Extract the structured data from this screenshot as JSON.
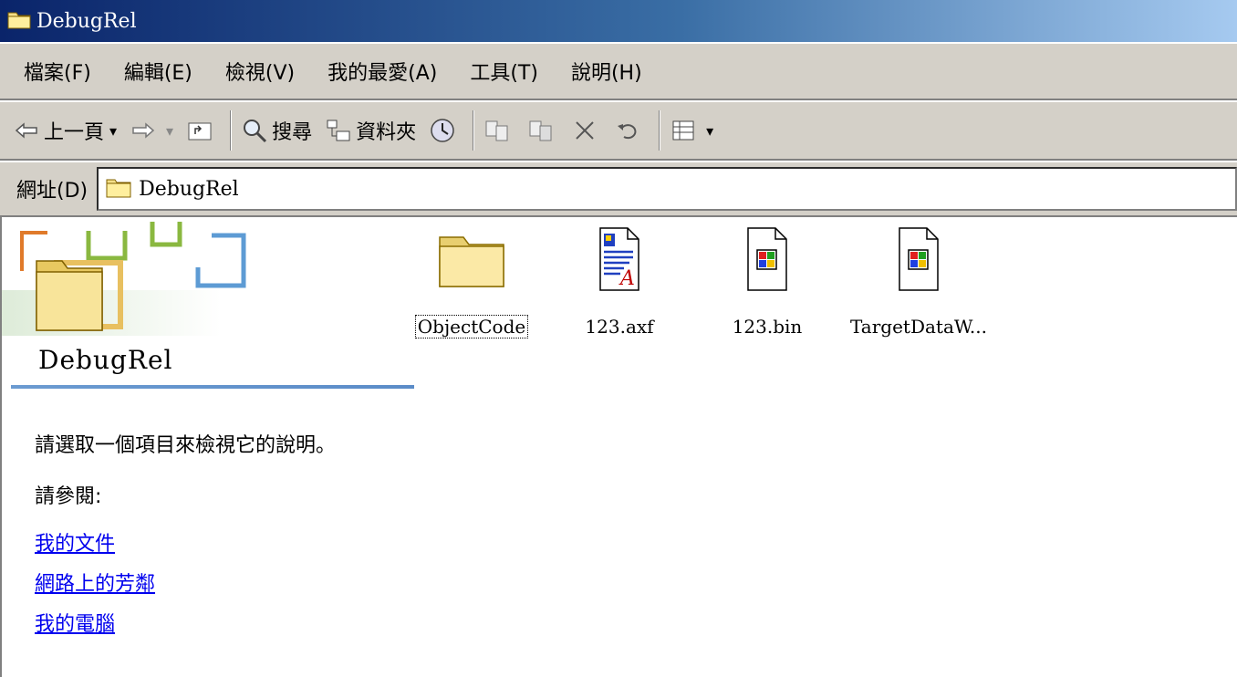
{
  "window": {
    "title": "DebugRel"
  },
  "menu": [
    "檔案(F)",
    "編輯(E)",
    "檢視(V)",
    "我的最愛(A)",
    "工具(T)",
    "說明(H)"
  ],
  "toolbar": {
    "back": "上一頁",
    "search": "搜尋",
    "folders": "資料夾"
  },
  "address": {
    "label": "網址(D)",
    "value": "DebugRel"
  },
  "left_pane": {
    "title": "DebugRel",
    "description": "請選取一個項目來檢視它的說明。",
    "see_also": "請參閱:",
    "links": [
      "我的文件",
      "網路上的芳鄰",
      "我的電腦"
    ]
  },
  "files": [
    {
      "name": "ObjectCode",
      "icon": "folder-icon"
    },
    {
      "name": "123.axf",
      "icon": "document-icon"
    },
    {
      "name": "123.bin",
      "icon": "windows-file-icon"
    },
    {
      "name": "TargetDataW...",
      "icon": "windows-file-icon"
    }
  ],
  "colors": {
    "link": "#0000ee",
    "folder": "#f5e08a",
    "chrome": "#d4d0c8"
  }
}
